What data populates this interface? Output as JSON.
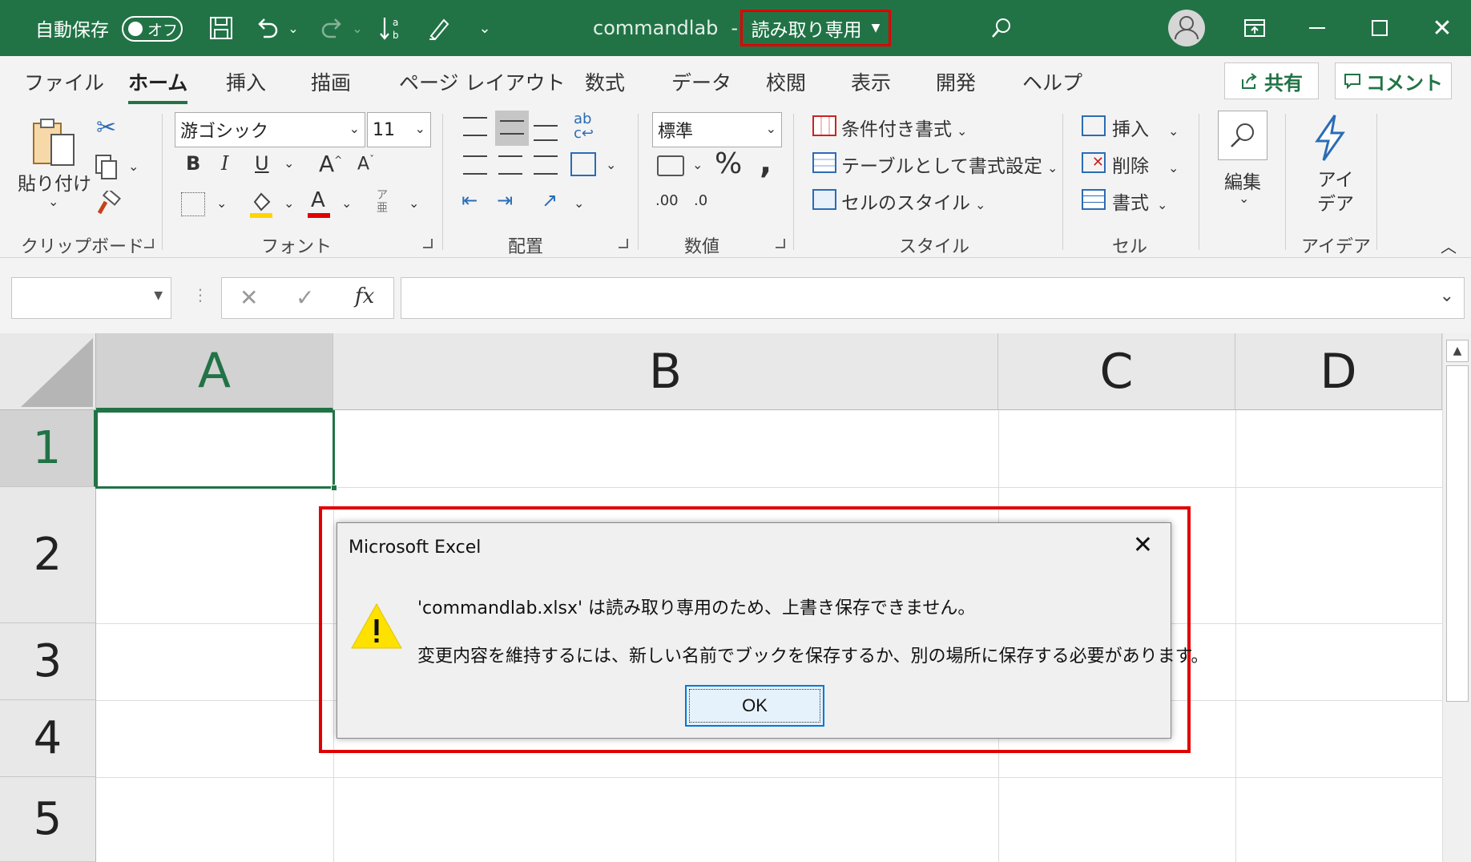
{
  "titlebar": {
    "autosave_label": "自動保存",
    "autosave_toggle": "オフ",
    "doc_name": "commandlab",
    "separator": "-",
    "readonly_label": "読み取り専用"
  },
  "tabs": [
    "ファイル",
    "ホーム",
    "挿入",
    "描画",
    "ページ レイアウト",
    "数式",
    "データ",
    "校閲",
    "表示",
    "開発",
    "ヘルプ"
  ],
  "active_tab": "ホーム",
  "share_label": "共有",
  "comment_label": "コメント",
  "ribbon": {
    "paste_label": "貼り付け",
    "clipboard_group": "クリップボード",
    "font_name": "游ゴシック",
    "font_size": "11",
    "font_group": "フォント",
    "align_group": "配置",
    "number_format": "標準",
    "number_group": "数値",
    "cond_format": "条件付き書式",
    "table_format": "テーブルとして書式設定",
    "cell_style": "セルのスタイル",
    "styles_group": "スタイル",
    "insert": "挿入",
    "delete": "削除",
    "format": "書式",
    "cells_group": "セル",
    "edit": "編集",
    "ideas_line1": "アイ",
    "ideas_line2": "デア",
    "ideas_group": "アイデア",
    "bold": "B",
    "italic": "I",
    "underline": "U",
    "phonetic": "ア亜",
    "percent": "%",
    "comma": ",",
    "decrease_decimal": ".00",
    "increase_decimal": ".0"
  },
  "formula": {
    "fx": "fx",
    "cancel": "✕",
    "enter": "✓"
  },
  "columns": [
    "A",
    "B",
    "C",
    "D"
  ],
  "rows": [
    "1",
    "2",
    "3",
    "4",
    "5"
  ],
  "dialog": {
    "title": "Microsoft Excel",
    "message1": "'commandlab.xlsx' は読み取り専用のため、上書き保存できません。",
    "message2": "変更内容を維持するには、新しい名前でブックを保存するか、別の場所に保存する必要があります。",
    "ok": "OK"
  },
  "colors": {
    "excel_green": "#217346",
    "highlight_red": "#e00000"
  }
}
